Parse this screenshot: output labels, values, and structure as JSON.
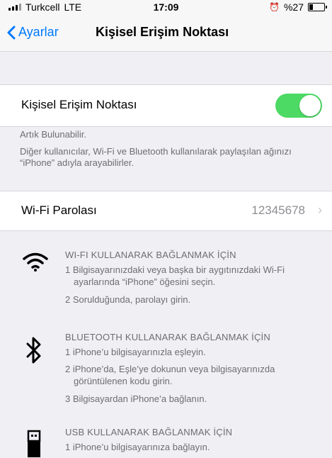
{
  "status_bar": {
    "carrier": "Turkcell",
    "network": "LTE",
    "time": "17:09",
    "battery": "%27",
    "battery_level": 0.27
  },
  "nav": {
    "back_label": "Ayarlar",
    "title": "Kişisel Erişim Noktası"
  },
  "hotspot": {
    "label": "Kişisel Erişim Noktası",
    "enabled": true,
    "footer_line1": "Artık Bulunabilir.",
    "footer_line2": "Diğer kullanıcılar, Wi-Fi ve Bluetooth kullanılarak paylaşılan ağınızı “iPhone” adıyla arayabilirler."
  },
  "wifi_password": {
    "label": "Wi-Fi Parolası",
    "value": "12345678"
  },
  "instructions": {
    "wifi": {
      "icon": "wifi-icon",
      "title": "WI-FI KULLANARAK BAĞLANMAK İÇİN",
      "steps": [
        "1 Bilgisayarınızdaki veya başka bir aygıtınızdaki Wi-Fi ayarlarında “iPhone” öğesini seçin.",
        "2 Sorulduğunda, parolayı girin."
      ]
    },
    "bluetooth": {
      "icon": "bluetooth-icon",
      "title": "BLUETOOTH KULLANARAK BAĞLANMAK İÇİN",
      "steps": [
        "1 iPhone’u bilgisayarınızla eşleyin.",
        "2 iPhone’da, Eşle’ye dokunun veya bilgisayarınızda görüntülenen kodu girin.",
        "3 Bilgisayardan iPhone’a bağlanın."
      ]
    },
    "usb": {
      "icon": "usb-icon",
      "title": "USB KULLANARAK BAĞLANMAK İÇİN",
      "steps": [
        "1 iPhone’u bilgisayarınıza bağlayın."
      ]
    }
  }
}
